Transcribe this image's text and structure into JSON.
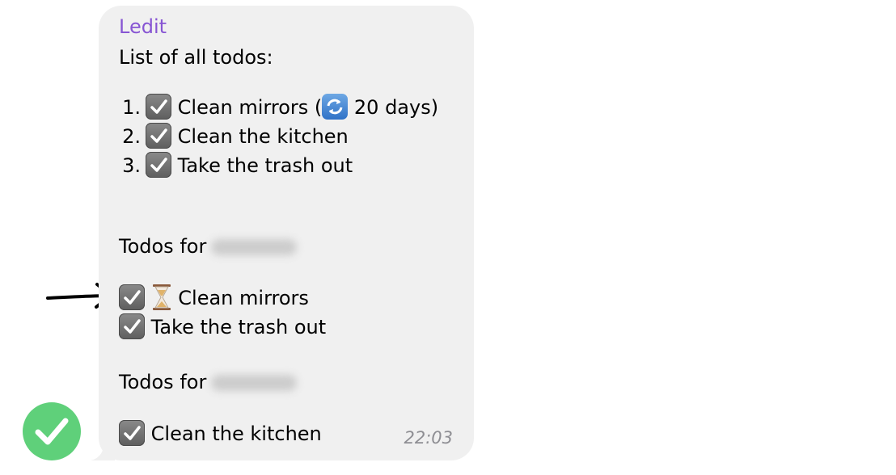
{
  "message": {
    "sender": "Ledit",
    "title": "List of all todos:",
    "all_todos": [
      {
        "number": "1.",
        "text_before": "Clean mirrors (",
        "icon": "repeat-icon",
        "text_after": " 20 days)"
      },
      {
        "number": "2.",
        "text": "Clean the kitchen"
      },
      {
        "number": "3.",
        "text": "Take the trash out"
      }
    ],
    "group1": {
      "heading": "Todos for",
      "items": [
        {
          "text": "Clean mirrors",
          "icon": "hourglass-icon"
        },
        {
          "text": "Take the trash out"
        }
      ]
    },
    "group2": {
      "heading": "Todos for",
      "items": [
        {
          "text": "Clean the kitchen"
        }
      ]
    },
    "time": "22:03"
  },
  "colors": {
    "sender": "#8755d3",
    "bubble": "#f0f0f0",
    "status_circle": "#5fd07a"
  }
}
